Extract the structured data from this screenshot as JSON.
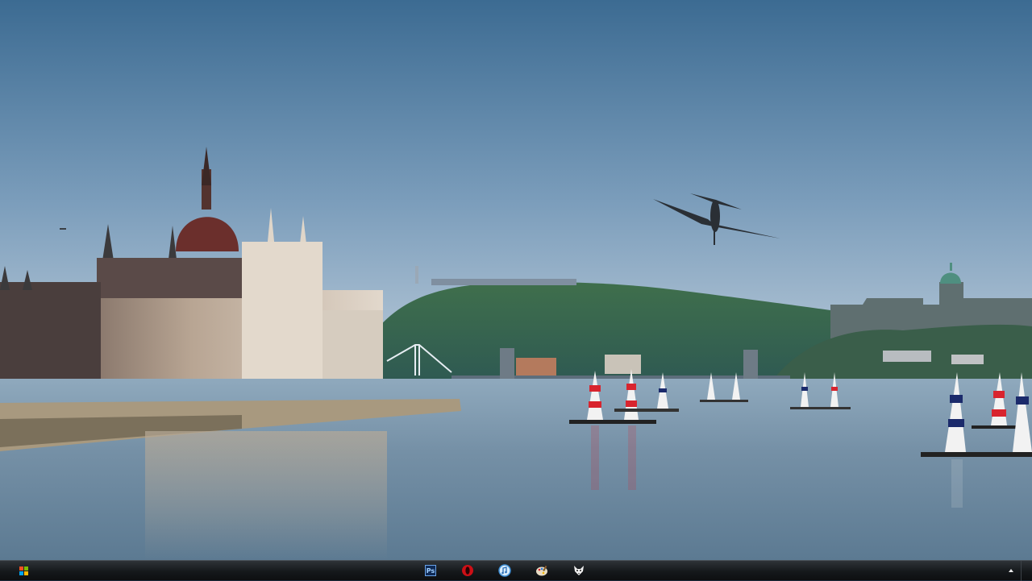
{
  "desktop": {
    "wallpaper": "budapest-air-race-parliament-danube"
  },
  "taskbar": {
    "start_icon": "windows-logo-icon",
    "pinned_apps": [
      {
        "name": "photoshop",
        "icon": "photoshop-icon",
        "label": "Ps"
      },
      {
        "name": "opera",
        "icon": "opera-icon"
      },
      {
        "name": "itunes",
        "icon": "itunes-icon"
      },
      {
        "name": "paint",
        "icon": "paint-palette-icon"
      },
      {
        "name": "fox",
        "icon": "fox-head-icon"
      }
    ],
    "tray_icon": "show-hidden-icons-arrow-icon"
  },
  "colors": {
    "sky_top": "#3d6d94",
    "sky_bottom": "#b8cad8",
    "water": "#6f8fa6",
    "taskbar": "#15181b",
    "pylon_red": "#d8242e",
    "pylon_blue": "#1b2a6b"
  }
}
